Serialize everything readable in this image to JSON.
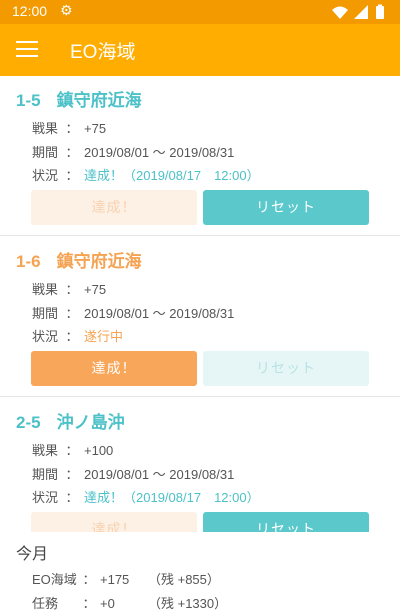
{
  "status_bar": {
    "time": "12:00",
    "icons": [
      "gear-icon",
      "wifi-icon",
      "signal-icon",
      "battery-icon"
    ]
  },
  "app_bar": {
    "title": "EO海域",
    "menu_icon": "hamburger-menu-icon"
  },
  "colors": {
    "primary": "#FFAD00",
    "status": "#F29A00",
    "teal": "#4CC1C8",
    "orange": "#F5A352"
  },
  "labels": {
    "result": "戦果",
    "period": "期間",
    "status": "状況",
    "colon": "："
  },
  "cards": [
    {
      "id": "1-5",
      "area": "鎮守府近海",
      "accent": "teal",
      "result": "+75",
      "period": "2019/08/01 ～ 2019/08/31",
      "status": "達成！（2019/08/17　12:00）",
      "achieve_label": "達成！",
      "achieve_enabled": false,
      "reset_label": "リセット",
      "reset_enabled": true
    },
    {
      "id": "1-6",
      "area": "鎮守府近海",
      "accent": "orange",
      "result": "+75",
      "period": "2019/08/01 ～ 2019/08/31",
      "status": "遂行中",
      "achieve_label": "達成！",
      "achieve_enabled": true,
      "reset_label": "リセット",
      "reset_enabled": false
    },
    {
      "id": "2-5",
      "area": "沖ノ島沖",
      "accent": "teal",
      "result": "+100",
      "period": "2019/08/01 ～ 2019/08/31",
      "status": "達成！（2019/08/17　12:00）",
      "achieve_label": "達成！",
      "achieve_enabled": false,
      "reset_label": "リセット",
      "reset_enabled": true
    }
  ],
  "summary": {
    "title": "今月",
    "rows": [
      {
        "label": "EO海域",
        "value": "+175",
        "remaining": "（残 +855）"
      },
      {
        "label": "任務",
        "value": "+0",
        "remaining": "（残 +1330）"
      }
    ]
  }
}
